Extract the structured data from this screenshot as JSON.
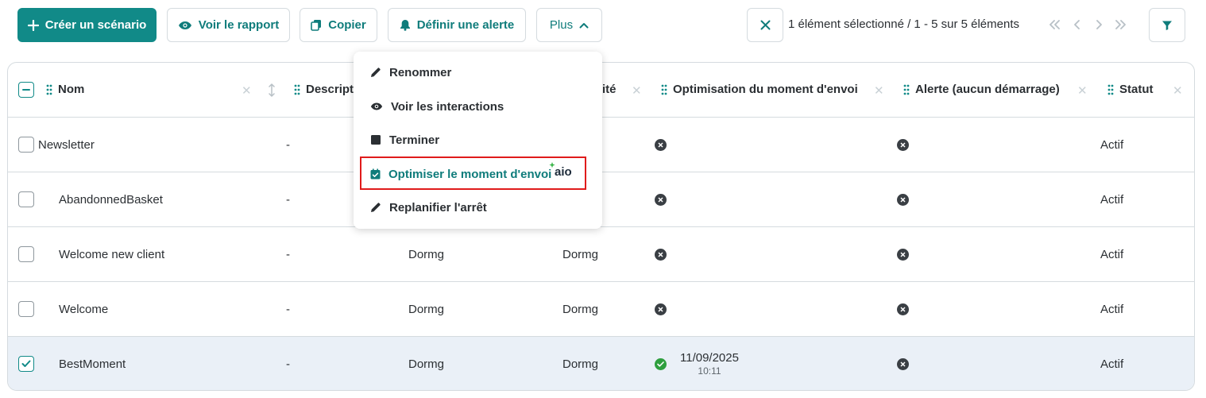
{
  "toolbar": {
    "create_label": "Créer un scénario",
    "report_label": "Voir le rapport",
    "copy_label": "Copier",
    "alert_label": "Définir une alerte",
    "more_label": "Plus",
    "selection_info": "1 élément sélectionné / 1 - 5 sur 5 éléments",
    "accent_color": "#118a88"
  },
  "menu": {
    "items": [
      {
        "label": "Renommer",
        "icon": "pencil-icon"
      },
      {
        "label": "Voir les interactions",
        "icon": "eye-icon"
      },
      {
        "label": "Terminer",
        "icon": "stop-icon"
      },
      {
        "label": "Optimiser le moment d'envoi",
        "icon": "calendar-check-icon",
        "badge": "aio"
      },
      {
        "label": "Replanifier l'arrêt",
        "icon": "pencil-icon"
      }
    ]
  },
  "table": {
    "columns": [
      "Nom",
      "Descript",
      "ité",
      "Optimisation du moment d'envoi",
      "Alerte (aucun démarrage)",
      "Statut"
    ],
    "rows": [
      {
        "name": "Newsletter",
        "description": "-",
        "col3": "",
        "col4": "",
        "optimisation": "cross",
        "alert": "cross",
        "status": "Actif",
        "selected": false
      },
      {
        "name": "AbandonnedBasket",
        "description": "-",
        "col3": "",
        "col4": "",
        "optimisation": "cross",
        "alert": "cross",
        "status": "Actif",
        "selected": false
      },
      {
        "name": "Welcome new client",
        "description": "-",
        "col3": "Dormg",
        "col4": "Dormg",
        "optimisation": "cross",
        "alert": "cross",
        "status": "Actif",
        "selected": false
      },
      {
        "name": "Welcome",
        "description": "-",
        "col3": "Dormg",
        "col4": "Dormg",
        "optimisation": "cross",
        "alert": "cross",
        "status": "Actif",
        "selected": false
      },
      {
        "name": "BestMoment",
        "description": "-",
        "col3": "Dormg",
        "col4": "Dormg",
        "optimisation": "check",
        "optimisation_date": "11/09/2025",
        "optimisation_time": "10:11",
        "alert": "cross",
        "status": "Actif",
        "selected": true
      }
    ]
  }
}
